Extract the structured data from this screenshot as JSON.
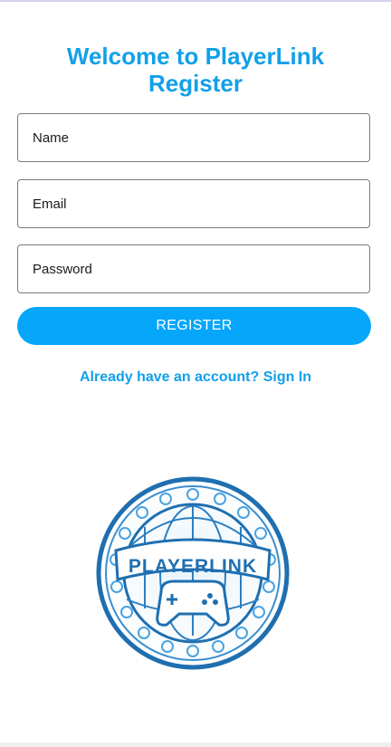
{
  "header": {
    "title_line1": "Welcome to PlayerLink",
    "title_line2": "Register"
  },
  "form": {
    "name_placeholder": "Name",
    "email_placeholder": "Email",
    "password_placeholder": "Password",
    "register_label": "REGISTER"
  },
  "signin": {
    "link_text": "Already have an account? Sign In"
  },
  "logo": {
    "text": "PLAYERLINK",
    "icon": "gamepad-icon"
  },
  "colors": {
    "accent": "#06a6fb",
    "title": "#12a0ea",
    "logo_blue": "#1f6fb0"
  }
}
